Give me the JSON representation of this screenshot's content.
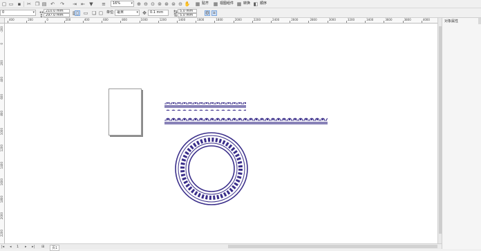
{
  "toolbar": {
    "icons": [
      "new-icon",
      "open-icon",
      "save-icon",
      "cut-icon",
      "copy-icon",
      "paste-icon",
      "undo-icon",
      "redo-icon",
      "import-icon",
      "export-icon",
      "publish-icon",
      "app-launcher-icon"
    ],
    "zoom_value": "16%",
    "zoom_icons": [
      "zoom-in-icon",
      "zoom-out-icon",
      "zoom-page-icon",
      "zoom-width-icon",
      "zoom-height-icon",
      "zoom-selected-icon",
      "zoom-all-icon",
      "pan-icon"
    ],
    "snap_label": "贴齐",
    "distribute_label": "视图组件",
    "transform_label": "转换",
    "align_label": "顺序"
  },
  "propbar": {
    "preset_value": "0",
    "width": "210.0 mm",
    "height": "297.0 mm",
    "units_label": "单位:",
    "units_value": "毫米",
    "nudge_value": "0.1 mm",
    "dup_x": "5.0 mm",
    "dup_y": "5.0 mm"
  },
  "ruler": {
    "h_labels": [
      "400",
      "200",
      "0",
      "200",
      "400",
      "600",
      "800",
      "1000",
      "1200",
      "1400",
      "1600",
      "1800",
      "2000",
      "2200",
      "2400",
      "2600",
      "2800",
      "3000",
      "3200",
      "3400",
      "3600",
      "3800",
      "4000"
    ],
    "v_labels": [
      "-200",
      "0",
      "200",
      "400",
      "600",
      "800",
      "1000",
      "1200",
      "1400",
      "1600",
      "1800",
      "2000",
      "2200"
    ],
    "unit": "毫米"
  },
  "docker": {
    "title": "对象属性"
  },
  "status": {
    "page_tab": "页1"
  }
}
